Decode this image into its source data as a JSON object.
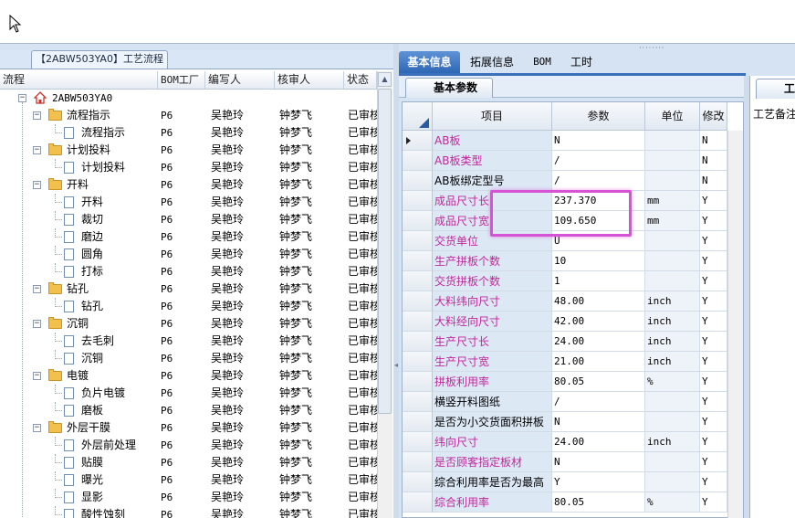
{
  "left_panel": {
    "title": "【2ABW503YA0】工艺流程",
    "columns": [
      "流程",
      "BOM工厂",
      "编写人",
      "核审人",
      "状态"
    ],
    "root": "2ABW503YA0",
    "rows": [
      {
        "label": "流程指示",
        "level": 1,
        "type": "folder",
        "bom": "P6",
        "author": "吴艳玲",
        "reviewer": "钟梦飞",
        "status": "已审核"
      },
      {
        "label": "流程指示",
        "level": 2,
        "type": "doc",
        "bom": "P6",
        "author": "吴艳玲",
        "reviewer": "钟梦飞",
        "status": "已审核"
      },
      {
        "label": "计划投料",
        "level": 1,
        "type": "folder",
        "bom": "P6",
        "author": "吴艳玲",
        "reviewer": "钟梦飞",
        "status": "已审核"
      },
      {
        "label": "计划投料",
        "level": 2,
        "type": "doc",
        "bom": "P6",
        "author": "吴艳玲",
        "reviewer": "钟梦飞",
        "status": "已审核"
      },
      {
        "label": "开料",
        "level": 1,
        "type": "folder",
        "bom": "P6",
        "author": "吴艳玲",
        "reviewer": "钟梦飞",
        "status": "已审核"
      },
      {
        "label": "开料",
        "level": 2,
        "type": "doc",
        "bom": "P6",
        "author": "吴艳玲",
        "reviewer": "钟梦飞",
        "status": "已审核",
        "selected": true
      },
      {
        "label": "裁切",
        "level": 2,
        "type": "doc",
        "bom": "P6",
        "author": "吴艳玲",
        "reviewer": "钟梦飞",
        "status": "已审核"
      },
      {
        "label": "磨边",
        "level": 2,
        "type": "doc",
        "bom": "P6",
        "author": "吴艳玲",
        "reviewer": "钟梦飞",
        "status": "已审核"
      },
      {
        "label": "圆角",
        "level": 2,
        "type": "doc",
        "bom": "P6",
        "author": "吴艳玲",
        "reviewer": "钟梦飞",
        "status": "已审核"
      },
      {
        "label": "打标",
        "level": 2,
        "type": "doc",
        "bom": "P6",
        "author": "吴艳玲",
        "reviewer": "钟梦飞",
        "status": "已审核"
      },
      {
        "label": "钻孔",
        "level": 1,
        "type": "folder",
        "bom": "P6",
        "author": "吴艳玲",
        "reviewer": "钟梦飞",
        "status": "已审核"
      },
      {
        "label": "钻孔",
        "level": 2,
        "type": "doc",
        "bom": "P6",
        "author": "吴艳玲",
        "reviewer": "钟梦飞",
        "status": "已审核"
      },
      {
        "label": "沉铜",
        "level": 1,
        "type": "folder",
        "bom": "P6",
        "author": "吴艳玲",
        "reviewer": "钟梦飞",
        "status": "已审核"
      },
      {
        "label": "去毛刺",
        "level": 2,
        "type": "doc",
        "bom": "P6",
        "author": "吴艳玲",
        "reviewer": "钟梦飞",
        "status": "已审核"
      },
      {
        "label": "沉铜",
        "level": 2,
        "type": "doc",
        "bom": "P6",
        "author": "吴艳玲",
        "reviewer": "钟梦飞",
        "status": "已审核"
      },
      {
        "label": "电镀",
        "level": 1,
        "type": "folder",
        "bom": "P6",
        "author": "吴艳玲",
        "reviewer": "钟梦飞",
        "status": "已审核"
      },
      {
        "label": "负片电镀",
        "level": 2,
        "type": "doc",
        "bom": "P6",
        "author": "吴艳玲",
        "reviewer": "钟梦飞",
        "status": "已审核"
      },
      {
        "label": "磨板",
        "level": 2,
        "type": "doc",
        "bom": "P6",
        "author": "吴艳玲",
        "reviewer": "钟梦飞",
        "status": "已审核"
      },
      {
        "label": "外层干膜",
        "level": 1,
        "type": "folder",
        "bom": "P6",
        "author": "吴艳玲",
        "reviewer": "钟梦飞",
        "status": "已审核"
      },
      {
        "label": "外层前处理",
        "level": 2,
        "type": "doc",
        "bom": "P6",
        "author": "吴艳玲",
        "reviewer": "钟梦飞",
        "status": "已审核"
      },
      {
        "label": "贴膜",
        "level": 2,
        "type": "doc",
        "bom": "P6",
        "author": "吴艳玲",
        "reviewer": "钟梦飞",
        "status": "已审核"
      },
      {
        "label": "曝光",
        "level": 2,
        "type": "doc",
        "bom": "P6",
        "author": "吴艳玲",
        "reviewer": "钟梦飞",
        "status": "已审核"
      },
      {
        "label": "显影",
        "level": 2,
        "type": "doc",
        "bom": "P6",
        "author": "吴艳玲",
        "reviewer": "钟梦飞",
        "status": "已审核"
      },
      {
        "label": "酸性蚀刻",
        "level": 2,
        "type": "doc",
        "bom": "P6",
        "author": "吴艳玲",
        "reviewer": "钟梦飞",
        "status": "已审核"
      }
    ]
  },
  "right_panel": {
    "tabs": [
      "基本信息",
      "拓展信息",
      "BOM",
      "工时"
    ],
    "active_tab": 0,
    "sub_tab": "基本参数",
    "columns": [
      "项目",
      "参数",
      "单位",
      "修改"
    ],
    "rows": [
      {
        "item": "AB板",
        "param": "N",
        "unit": "",
        "mod": "N",
        "color": "magenta",
        "current": true
      },
      {
        "item": "AB板类型",
        "param": "/",
        "unit": "",
        "mod": "N",
        "color": "magenta"
      },
      {
        "item": "AB板绑定型号",
        "param": "/",
        "unit": "",
        "mod": "N",
        "color": "black"
      },
      {
        "item": "成品尺寸长",
        "param": "237.370",
        "unit": "mm",
        "mod": "Y",
        "color": "magenta"
      },
      {
        "item": "成品尺寸宽",
        "param": "109.650",
        "unit": "mm",
        "mod": "Y",
        "color": "magenta"
      },
      {
        "item": "交货单位",
        "param": "U",
        "unit": "",
        "mod": "Y",
        "color": "magenta"
      },
      {
        "item": "生产拼板个数",
        "param": "10",
        "unit": "",
        "mod": "Y",
        "color": "magenta"
      },
      {
        "item": "交货拼板个数",
        "param": "1",
        "unit": "",
        "mod": "Y",
        "color": "magenta"
      },
      {
        "item": "大料纬向尺寸",
        "param": "48.00",
        "unit": "inch",
        "mod": "Y",
        "color": "magenta"
      },
      {
        "item": "大料经向尺寸",
        "param": "42.00",
        "unit": "inch",
        "mod": "Y",
        "color": "magenta"
      },
      {
        "item": "生产尺寸长",
        "param": "24.00",
        "unit": "inch",
        "mod": "Y",
        "color": "magenta"
      },
      {
        "item": "生产尺寸宽",
        "param": "21.00",
        "unit": "inch",
        "mod": "Y",
        "color": "magenta"
      },
      {
        "item": "拼板利用率",
        "param": "80.05",
        "unit": "%",
        "mod": "Y",
        "color": "magenta"
      },
      {
        "item": "横竖开料图纸",
        "param": "/",
        "unit": "",
        "mod": "Y",
        "color": "black"
      },
      {
        "item": "是否为小交货面积拼板",
        "param": "N",
        "unit": "",
        "mod": "Y",
        "color": "black"
      },
      {
        "item": "纬向尺寸",
        "param": "24.00",
        "unit": "inch",
        "mod": "Y",
        "color": "magenta"
      },
      {
        "item": "是否顾客指定板材",
        "param": "N",
        "unit": "",
        "mod": "Y",
        "color": "magenta"
      },
      {
        "item": "综合利用率是否为最高",
        "param": "Y",
        "unit": "",
        "mod": "Y",
        "color": "black"
      },
      {
        "item": "综合利用率",
        "param": "80.05",
        "unit": "%",
        "mod": "Y",
        "color": "magenta"
      }
    ]
  },
  "far_panel": {
    "tab": "工艺备注",
    "label": "工艺备注"
  },
  "colors": {
    "magenta_text": "#c0289a",
    "selected_row": "#fde19a",
    "active_tab": "#3a70bb",
    "highlight_box": "#d653d6"
  }
}
